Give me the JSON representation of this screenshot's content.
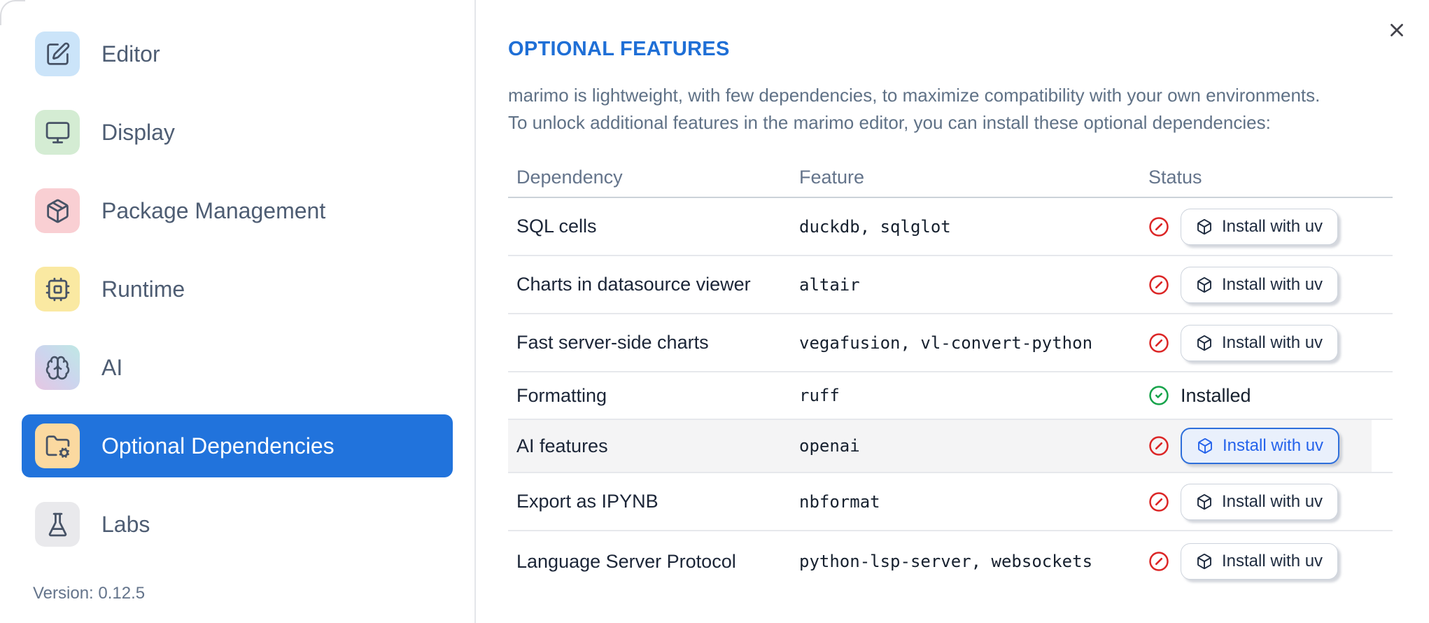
{
  "sidebar": {
    "items": [
      {
        "label": "Editor",
        "icon": "square-pen",
        "icon_bg": "#cbe4f9",
        "selected": false
      },
      {
        "label": "Display",
        "icon": "monitor",
        "icon_bg": "#d4ecd3",
        "selected": false
      },
      {
        "label": "Package Management",
        "icon": "package",
        "icon_bg": "#f9cfd3",
        "selected": false
      },
      {
        "label": "Runtime",
        "icon": "cpu",
        "icon_bg": "#fae9a2",
        "selected": false
      },
      {
        "label": "AI",
        "icon": "brain",
        "icon_bg": "linear-gradient(45deg, #e6c6e2, #ccd5ee 52%, #bfe8e4)",
        "selected": false
      },
      {
        "label": "Optional Dependencies",
        "icon": "folder-cog",
        "icon_bg": "#fbd9a0",
        "selected": true
      },
      {
        "label": "Labs",
        "icon": "flask",
        "icon_bg": "#e9e9ec",
        "selected": false
      }
    ],
    "version_label": "Version: 0.12.5"
  },
  "dialog": {
    "title": "OPTIONAL FEATURES",
    "description_line1": "marimo is lightweight, with few dependencies, to maximize compatibility with your own environments.",
    "description_line2": "To unlock additional features in the marimo editor, you can install these optional dependencies:"
  },
  "table": {
    "columns": [
      "Dependency",
      "Feature",
      "Status"
    ],
    "install_button_label": "Install with uv",
    "installed_label": "Installed",
    "rows": [
      {
        "dependency": "SQL cells",
        "feature": "duckdb, sqlglot",
        "installed": false,
        "focused": false,
        "highlighted": false
      },
      {
        "dependency": "Charts in datasource viewer",
        "feature": "altair",
        "installed": false,
        "focused": false,
        "highlighted": false
      },
      {
        "dependency": "Fast server-side charts",
        "feature": "vegafusion, vl-convert-python",
        "installed": false,
        "focused": false,
        "highlighted": false
      },
      {
        "dependency": "Formatting",
        "feature": "ruff",
        "installed": true,
        "focused": false,
        "highlighted": false
      },
      {
        "dependency": "AI features",
        "feature": "openai",
        "installed": false,
        "focused": true,
        "highlighted": true
      },
      {
        "dependency": "Export as IPYNB",
        "feature": "nbformat",
        "installed": false,
        "focused": false,
        "highlighted": false
      },
      {
        "dependency": "Language Server Protocol",
        "feature": "python-lsp-server, websockets",
        "installed": false,
        "focused": false,
        "highlighted": false
      }
    ]
  },
  "colors": {
    "accent_blue": "#2173dc",
    "title_blue": "#1f6fd6",
    "focused_button_blue": "#2563eb",
    "status_error_red": "#dc2626",
    "status_success_green": "#16a34a"
  }
}
